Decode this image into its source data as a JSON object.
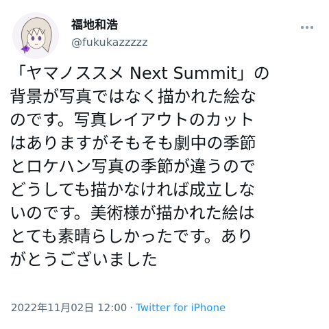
{
  "author": {
    "display_name": "福地和浩",
    "handle": "@fukukazzzzz"
  },
  "icons": {
    "avatar": "anime-avatar-icon",
    "more": "more-options-icon"
  },
  "tweet": {
    "lines": [
      "「ヤマノススメ Next Summit」の",
      "背景が写真ではなく描かれた絵な",
      "のです。写真レイアウトのカット",
      "はありますがそもそも劇中の季節",
      "とロケハン写真の季節が違うので",
      "どうしても描かなければ成立しな",
      "いのです。美術様が描かれた絵は",
      "とても素晴らしかったです。あり",
      "がとうございました"
    ],
    "timestamp": "2022年11月02日 12:00",
    "separator": "·",
    "client": "Twitter for iPhone"
  },
  "colors": {
    "text": "#0f1419",
    "secondary": "#536471",
    "link": "#1d9bf0"
  }
}
